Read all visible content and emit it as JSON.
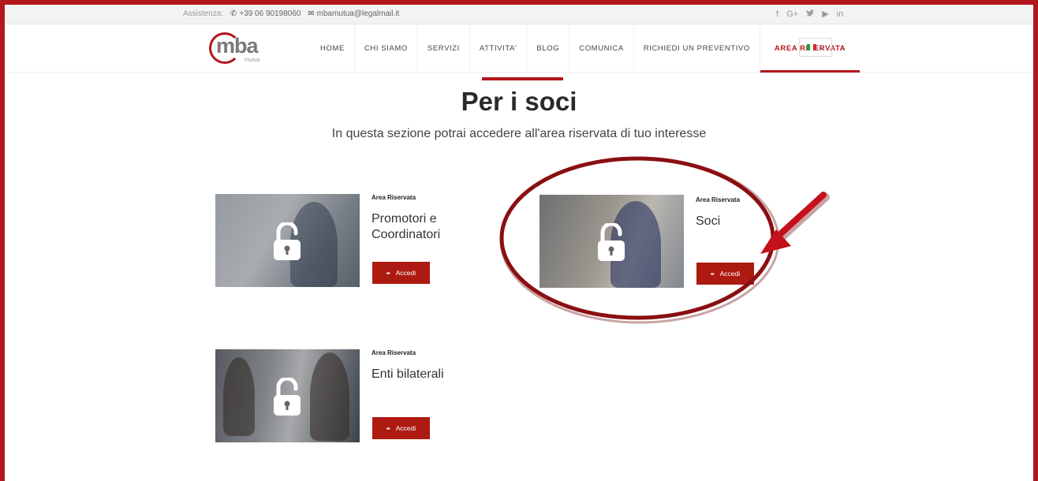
{
  "topbar": {
    "assistance_label": "Assistenza:",
    "phone": "+39 06 90198060",
    "email": "mbamutua@legalmail.it",
    "social": [
      "f",
      "G+",
      "🐦",
      "▶",
      "in"
    ]
  },
  "logo": {
    "text": "mba",
    "sub": "mutua"
  },
  "nav": {
    "items": [
      "HOME",
      "CHI SIAMO",
      "SERVIZI",
      "ATTIVITA'",
      "BLOG",
      "COMUNICA",
      "RICHIEDI UN PREVENTIVO",
      "AREA RISERVATA"
    ],
    "active": "AREA RISERVATA",
    "language_caret": "⌄"
  },
  "page": {
    "title": "Per i soci",
    "subtitle": "In questa sezione potrai accedere all'area riservata di tuo interesse"
  },
  "cards": [
    {
      "kicker": "Area Riservata",
      "name": "Promotori e Coordinatori",
      "button": "Accedi"
    },
    {
      "kicker": "Area Riservata",
      "name": "Soci",
      "button": "Accedi"
    },
    {
      "kicker": "Area Riservata",
      "name": "Enti bilaterali",
      "button": "Accedi"
    }
  ],
  "colors": {
    "accent": "#b3161b",
    "button": "#ad1a12",
    "annotation": "#8a0f12"
  }
}
